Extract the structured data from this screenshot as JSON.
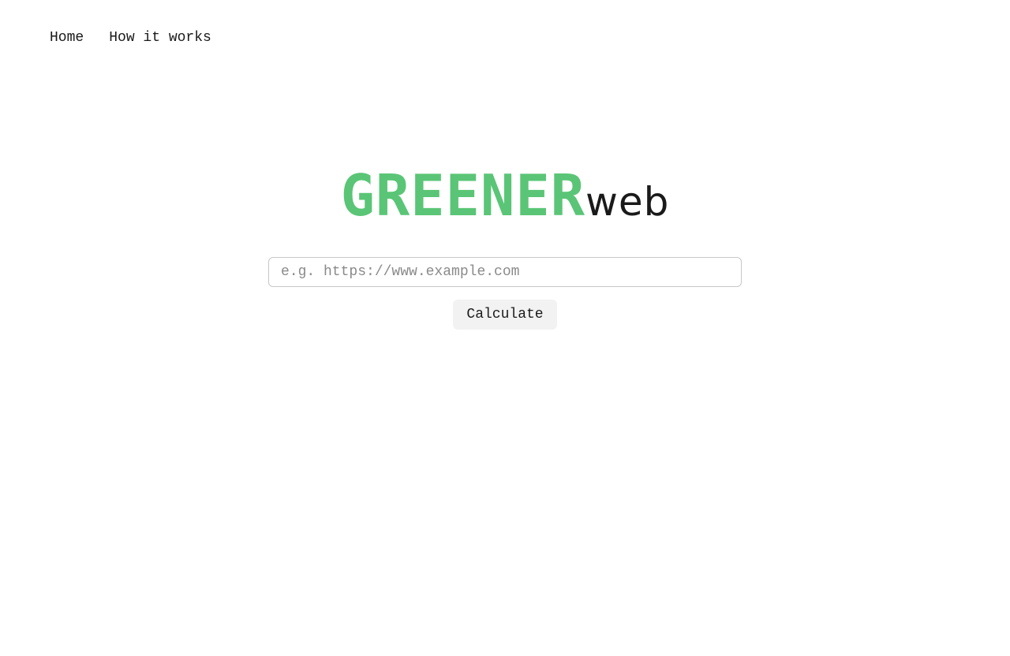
{
  "nav": {
    "items": [
      {
        "label": "Home"
      },
      {
        "label": "How it works"
      }
    ]
  },
  "logo": {
    "primary": "GREENER",
    "secondary": "web"
  },
  "search": {
    "value": "",
    "placeholder": "e.g. https://www.example.com"
  },
  "actions": {
    "calculate_label": "Calculate"
  },
  "colors": {
    "brand_green": "#5ac576",
    "text": "#1a1a1a",
    "button_bg": "#f2f2f2",
    "input_border": "#c8c8c8"
  }
}
